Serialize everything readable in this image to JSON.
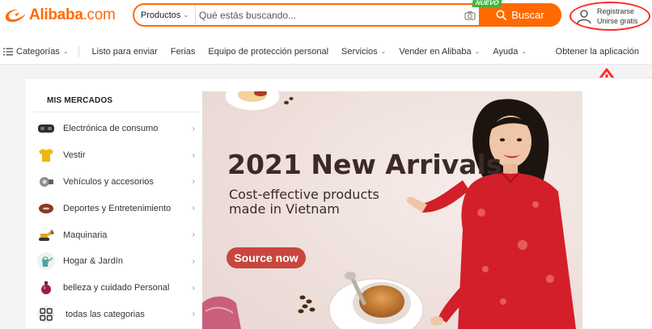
{
  "header": {
    "logo_text": "Alibaba",
    "logo_suffix": ".com",
    "search": {
      "category_label": "Productos",
      "placeholder": "Qué estás buscando...",
      "badge": "NUEVO",
      "button_label": "Buscar"
    },
    "account": {
      "register": "Registrarse",
      "join": "Unirse gratis"
    }
  },
  "nav": {
    "items": [
      {
        "label": "Categorías"
      },
      {
        "label": "Listo para enviar"
      },
      {
        "label": "Ferias"
      },
      {
        "label": "Equipo de protección personal"
      },
      {
        "label": "Servicios"
      },
      {
        "label": "Vender en Alibaba"
      },
      {
        "label": "Ayuda"
      }
    ],
    "right_label": "Obtener la aplicación"
  },
  "sidebar": {
    "title": "MIS MERCADOS",
    "items": [
      {
        "label": "Electrónica de consumo",
        "icon": "vr-headset-icon"
      },
      {
        "label": "Vestir",
        "icon": "tshirt-icon"
      },
      {
        "label": "Vehículos y accesorios",
        "icon": "car-part-icon"
      },
      {
        "label": "Deportes y Entretenimiento",
        "icon": "football-icon"
      },
      {
        "label": "Maquinaria",
        "icon": "excavator-icon"
      },
      {
        "label": "Hogar & Jardín",
        "icon": "watering-can-icon"
      },
      {
        "label": "belleza y cuidado Personal",
        "icon": "perfume-icon"
      },
      {
        "label": "todas las categorias",
        "icon": "grid-icon"
      }
    ]
  },
  "banner": {
    "headline": "2021 New Arrivals",
    "subline1": "Cost-effective products",
    "subline2": "made in Vietnam",
    "cta": "Source now"
  },
  "colors": {
    "brand": "#ff6a00",
    "annotation": "#ff2a2a",
    "banner_bg": "#f1e4e0",
    "cta_bg": "#c8463d"
  }
}
